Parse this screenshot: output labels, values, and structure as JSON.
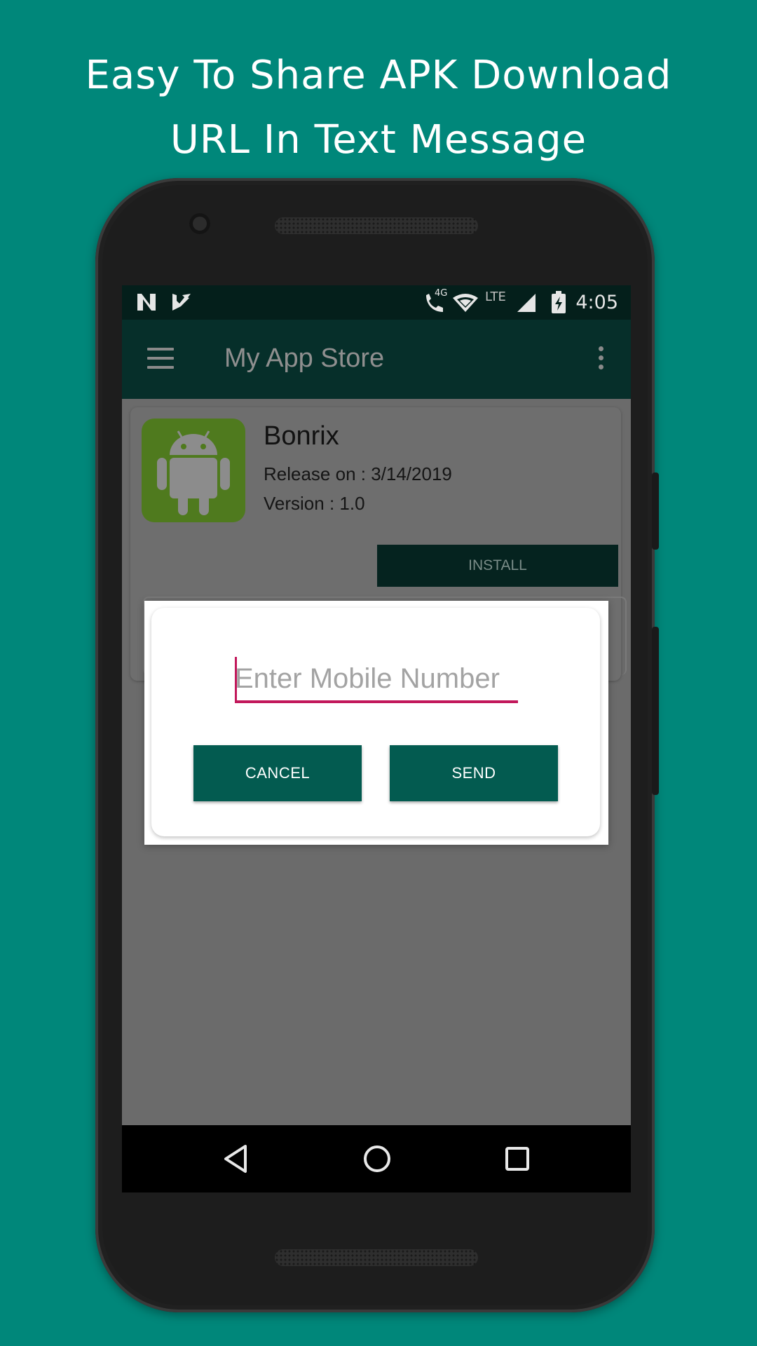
{
  "promo": {
    "line1": "Easy To Share APK Download",
    "line2": "URL In Text Message"
  },
  "status_bar": {
    "time": "4:05",
    "network_label": "LTE",
    "call_label": "4G"
  },
  "toolbar": {
    "title": "My App Store"
  },
  "app_card": {
    "name": "Bonrix",
    "release": "Release on : 3/14/2019",
    "version": "Version : 1.0",
    "install_label": "INSTALL"
  },
  "dialog": {
    "input_placeholder": "Enter Mobile Number",
    "input_value": "",
    "cancel_label": "CANCEL",
    "send_label": "SEND"
  },
  "colors": {
    "background": "#00877a",
    "toolbar": "#062f2a",
    "button": "#035b50",
    "input_accent": "#c2185b"
  },
  "icons": [
    "n-notification-icon",
    "store-notification-icon",
    "wifi-call-icon",
    "wifi-icon",
    "signal-icon",
    "battery-charging-icon",
    "menu-icon",
    "more-vert-icon",
    "android-icon",
    "back-icon",
    "home-icon",
    "recents-icon"
  ]
}
